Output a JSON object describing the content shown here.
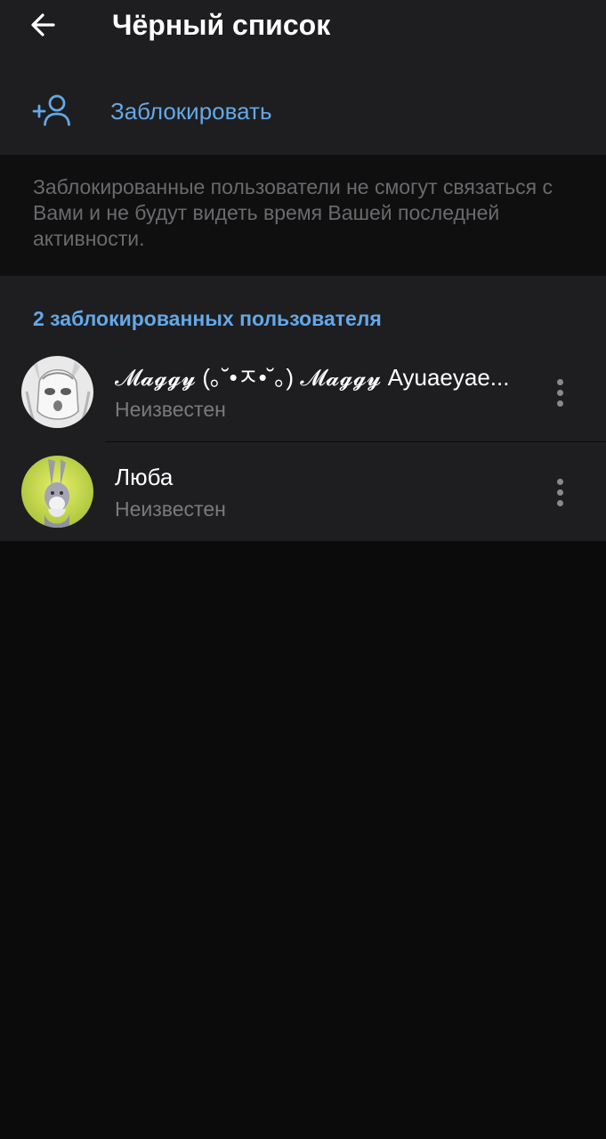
{
  "header": {
    "title": "Чёрный список",
    "back_icon": "arrow-left-icon"
  },
  "block_action": {
    "icon": "add-user-icon",
    "label": "Заблокировать"
  },
  "info": {
    "text": "Заблокированные пользователи не смогут связаться с Вами и не будут видеть время Вашей последней активности."
  },
  "blocked": {
    "header": "2 заблокированных пользователя",
    "users": [
      {
        "name": "𝓜𝓪𝓰𝓰𝔂 (｡˘•ㅈ•˘｡) 𝓜𝓪𝓰𝓰𝔂 Ayuaeyae...",
        "status": "Неизвестен"
      },
      {
        "name": "Люба",
        "status": "Неизвестен"
      }
    ]
  },
  "colors": {
    "accent": "#64a8e8",
    "header_bg": "#1e1e20",
    "page_bg": "#0b0b0c",
    "secondary_text": "#7a7a7e"
  }
}
